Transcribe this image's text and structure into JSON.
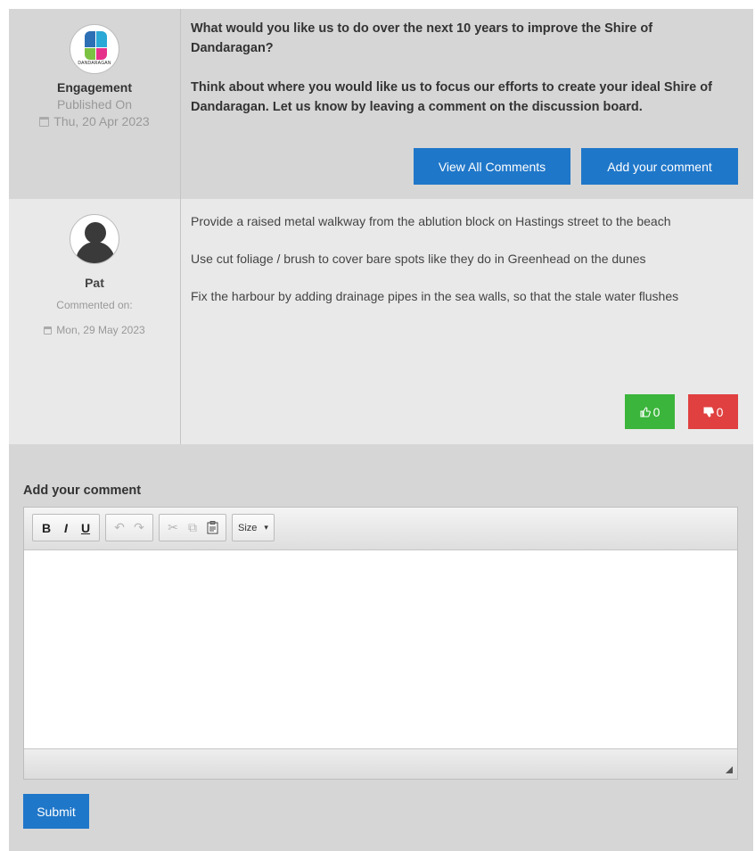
{
  "engagement": {
    "title": "Engagement",
    "published_label": "Published On",
    "published_date": "Thu, 20 Apr 2023",
    "logo_text": "DANDARAGAN",
    "question_line1": "What would you like us to do over the next 10 years to improve the Shire of Dandaragan?",
    "question_line2": "Think about where you would like us to focus our efforts to create your ideal Shire of Dandaragan. Let us know by leaving a comment on the discussion board.",
    "view_all_button": "View All Comments",
    "add_comment_button": "Add your comment"
  },
  "comment": {
    "author": "Pat",
    "commented_label": "Commented on:",
    "date": "Mon, 29 May 2023",
    "paragraphs": [
      "Provide a raised metal walkway from the ablution block on Hastings street to the beach",
      "Use cut foliage  / brush to cover bare spots like they do in Greenhead on the dunes",
      "Fix the harbour by adding drainage pipes in the sea walls, so that the stale water flushes"
    ],
    "upvotes": "0",
    "downvotes": "0"
  },
  "form": {
    "title": "Add your comment",
    "toolbar": {
      "bold": "B",
      "italic": "I",
      "underline": "U",
      "undo": "↶",
      "redo": "↷",
      "cut": "✂",
      "copy": "⧉",
      "paste": "📋",
      "size_label": "Size",
      "size_caret": "▾"
    },
    "submit_label": "Submit"
  },
  "colors": {
    "primary": "#1f77c9",
    "upvote": "#3bb53b",
    "downvote": "#e04040"
  }
}
